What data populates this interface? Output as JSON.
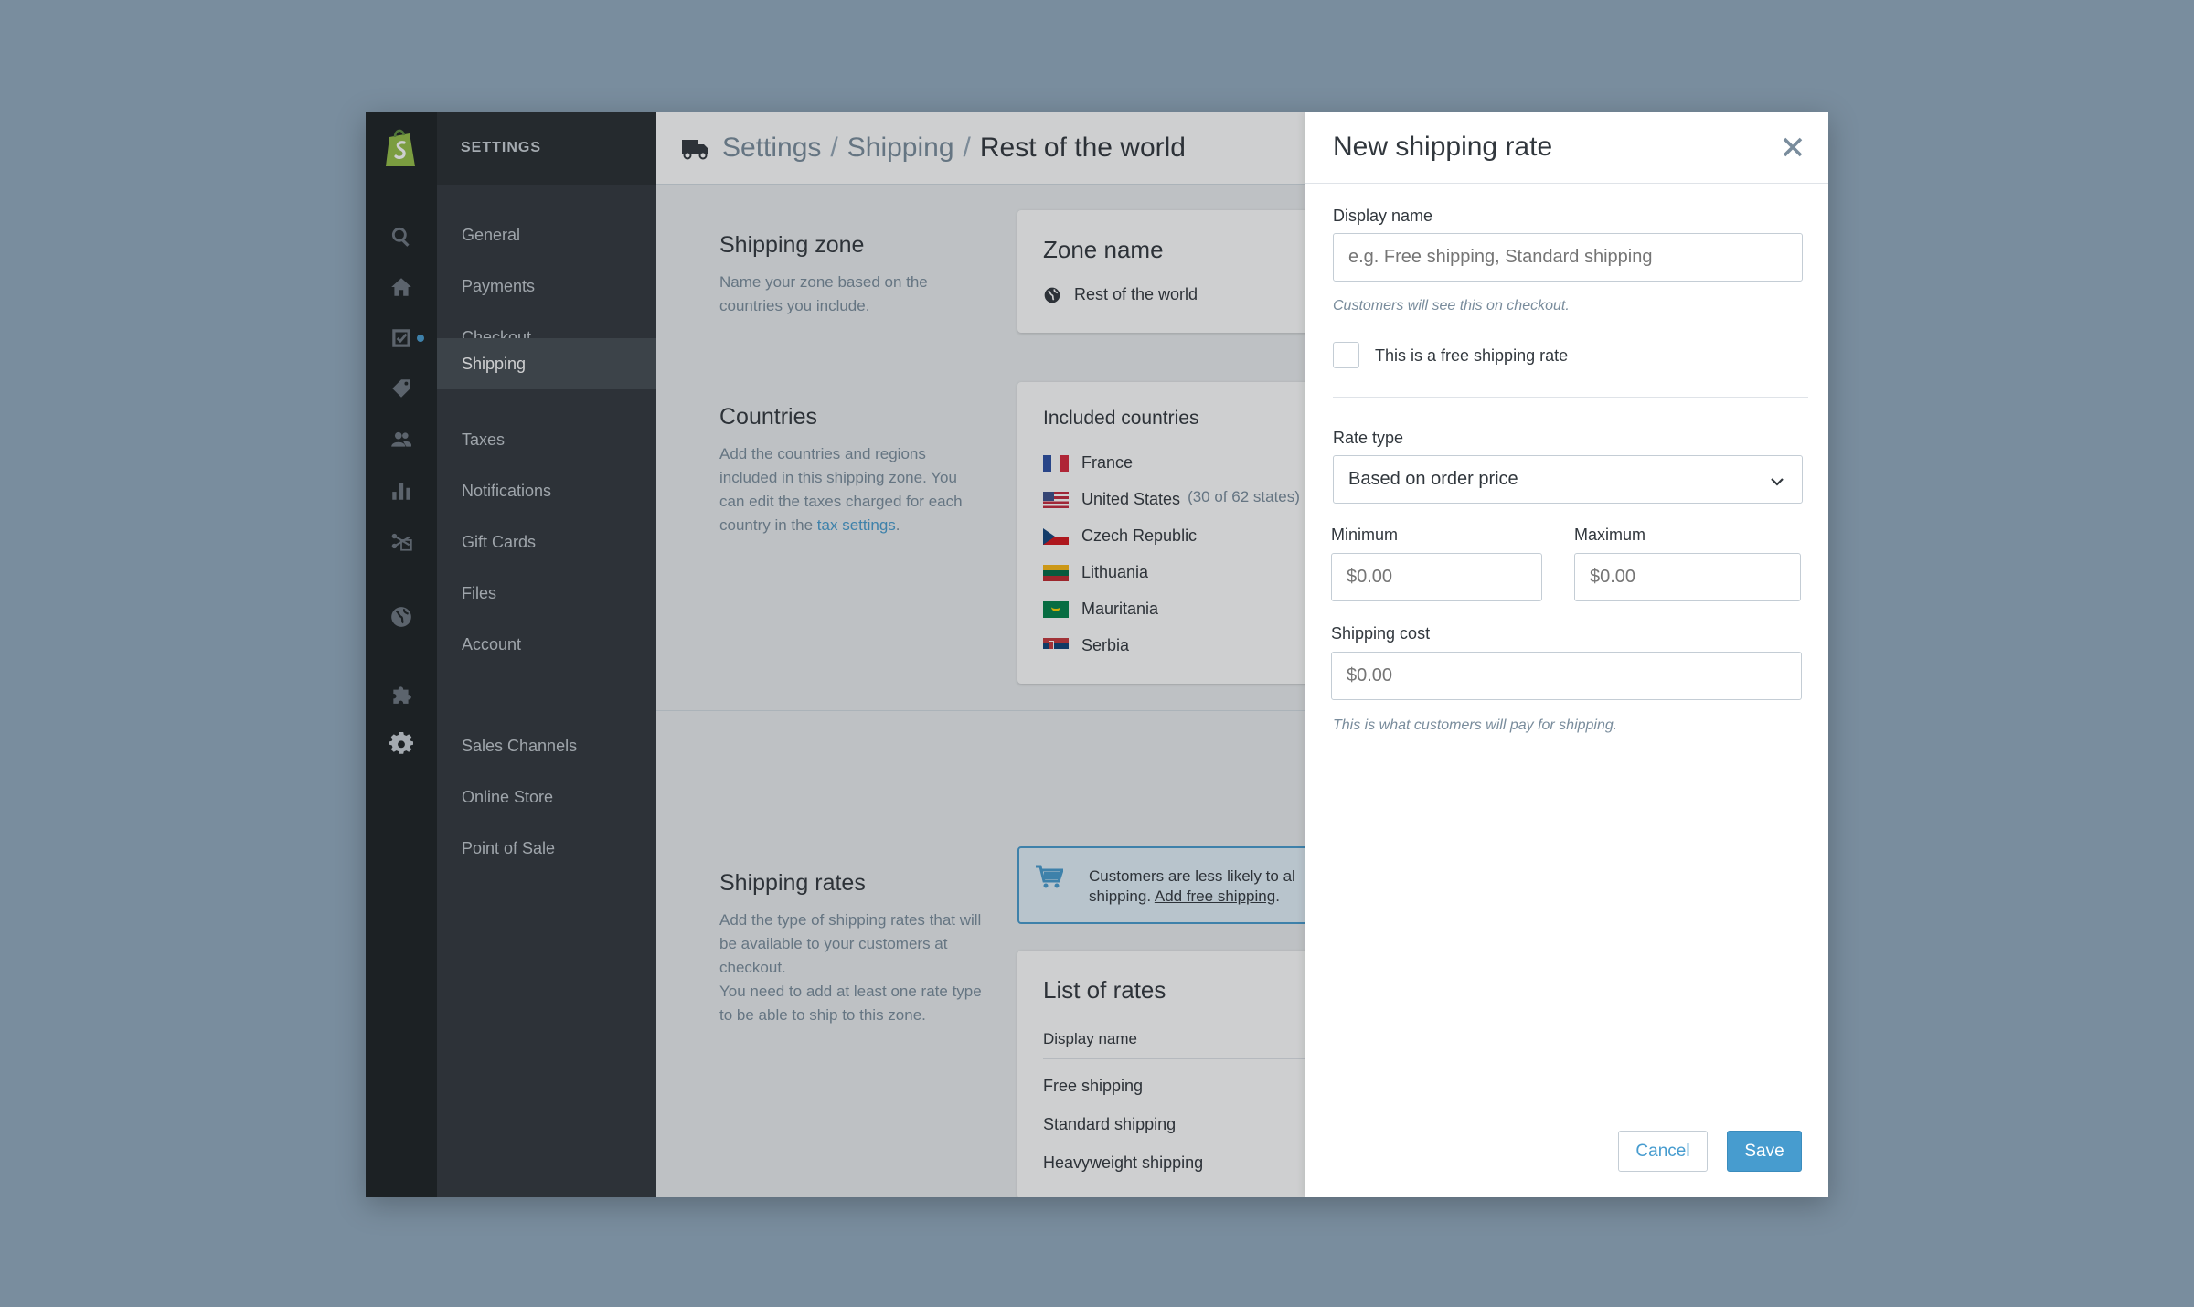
{
  "nav": {
    "header": "SETTINGS",
    "items": [
      "General",
      "Payments",
      "Checkout",
      "Shipping",
      "Taxes",
      "Notifications",
      "Gift Cards",
      "Files",
      "Account"
    ],
    "active": "Shipping",
    "channels": [
      "Sales Channels",
      "Online Store",
      "Point of Sale"
    ]
  },
  "breadcrumb": {
    "settings": "Settings",
    "shipping": "Shipping",
    "current": "Rest of the world",
    "sep": "/"
  },
  "zone": {
    "title": "Shipping zone",
    "desc": "Name your zone based on the countries you include.",
    "card_title": "Zone name",
    "value": "Rest of the world"
  },
  "countries": {
    "title": "Countries",
    "desc": "Add the countries and regions included in this shipping zone. You can edit the taxes charged for each country in the",
    "link": "tax settings",
    "desc_end": ".",
    "card_title": "Included countries",
    "list": [
      {
        "name": "France",
        "sub": ""
      },
      {
        "name": "United States",
        "sub": "(30 of 62 states)"
      },
      {
        "name": "Czech Republic",
        "sub": ""
      },
      {
        "name": "Lithuania",
        "sub": ""
      },
      {
        "name": "Mauritania",
        "sub": ""
      },
      {
        "name": "Serbia",
        "sub": ""
      }
    ]
  },
  "rates": {
    "title": "Shipping rates",
    "desc1": "Add the type of shipping rates that will be available to your customers at checkout.",
    "desc2": "You need to add at least one rate type to be able to ship to this zone.",
    "banner_line1": "Customers are less likely to al",
    "banner_line2": "shipping.",
    "banner_link": "Add free shipping",
    "banner_end": ".",
    "card_title": "List of rates",
    "column": "Display name",
    "rows": [
      "Free shipping",
      "Standard shipping",
      "Heavyweight shipping"
    ]
  },
  "panel": {
    "title": "New shipping rate",
    "display_name_label": "Display name",
    "display_name_placeholder": "e.g. Free shipping, Standard shipping",
    "display_name_help": "Customers will see this on checkout.",
    "free_rate_label": "This is a free shipping rate",
    "free_rate_checked": false,
    "rate_type_label": "Rate type",
    "rate_type_value": "Based on order price",
    "minimum_label": "Minimum",
    "minimum_placeholder": "$0.00",
    "maximum_label": "Maximum",
    "maximum_placeholder": "$0.00",
    "cost_label": "Shipping cost",
    "cost_placeholder": "$0.00",
    "cost_help": "This is what customers will pay for shipping.",
    "cancel": "Cancel",
    "save": "Save"
  },
  "colors": {
    "accent": "#479ccf",
    "nav_bg": "#31373d",
    "rail_bg": "#1c2023",
    "backdrop": "#798d9e",
    "logo": "#95bf47"
  }
}
